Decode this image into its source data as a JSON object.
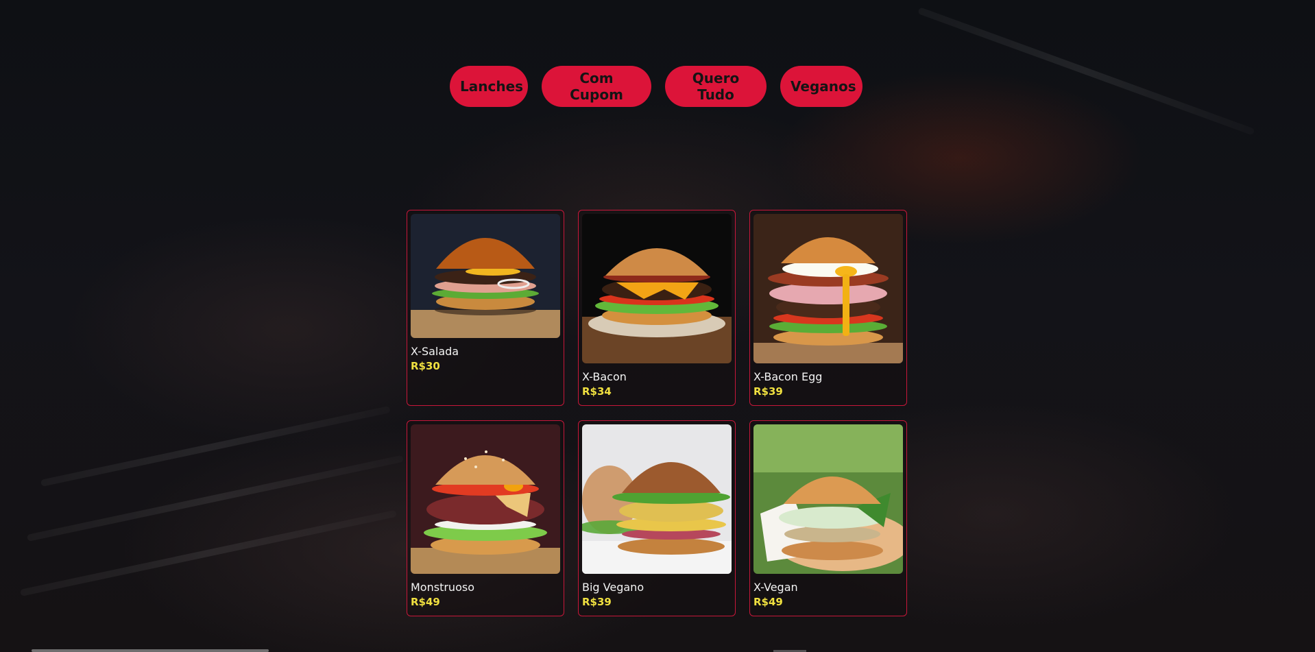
{
  "nav": {
    "buttons": [
      "Lanches",
      "Com Cupom",
      "Quero Tudo",
      "Veganos"
    ]
  },
  "menu": {
    "items": [
      {
        "name": "X-Salada",
        "price": "R$30",
        "image": "burger-x-salada-photo"
      },
      {
        "name": "X-Bacon",
        "price": "R$34",
        "image": "burger-x-bacon-photo"
      },
      {
        "name": "X-Bacon Egg",
        "price": "R$39",
        "image": "burger-x-bacon-egg-photo"
      },
      {
        "name": "Monstruoso",
        "price": "R$49",
        "image": "burger-monstruoso-photo"
      },
      {
        "name": "Big Vegano",
        "price": "R$39",
        "image": "burger-big-vegano-photo"
      },
      {
        "name": "X-Vegan",
        "price": "R$49",
        "image": "burger-x-vegan-photo"
      }
    ]
  },
  "colors": {
    "accent": "#dc1439",
    "price": "#f0e040",
    "text": "#f4f4f4",
    "background": "#121216"
  }
}
